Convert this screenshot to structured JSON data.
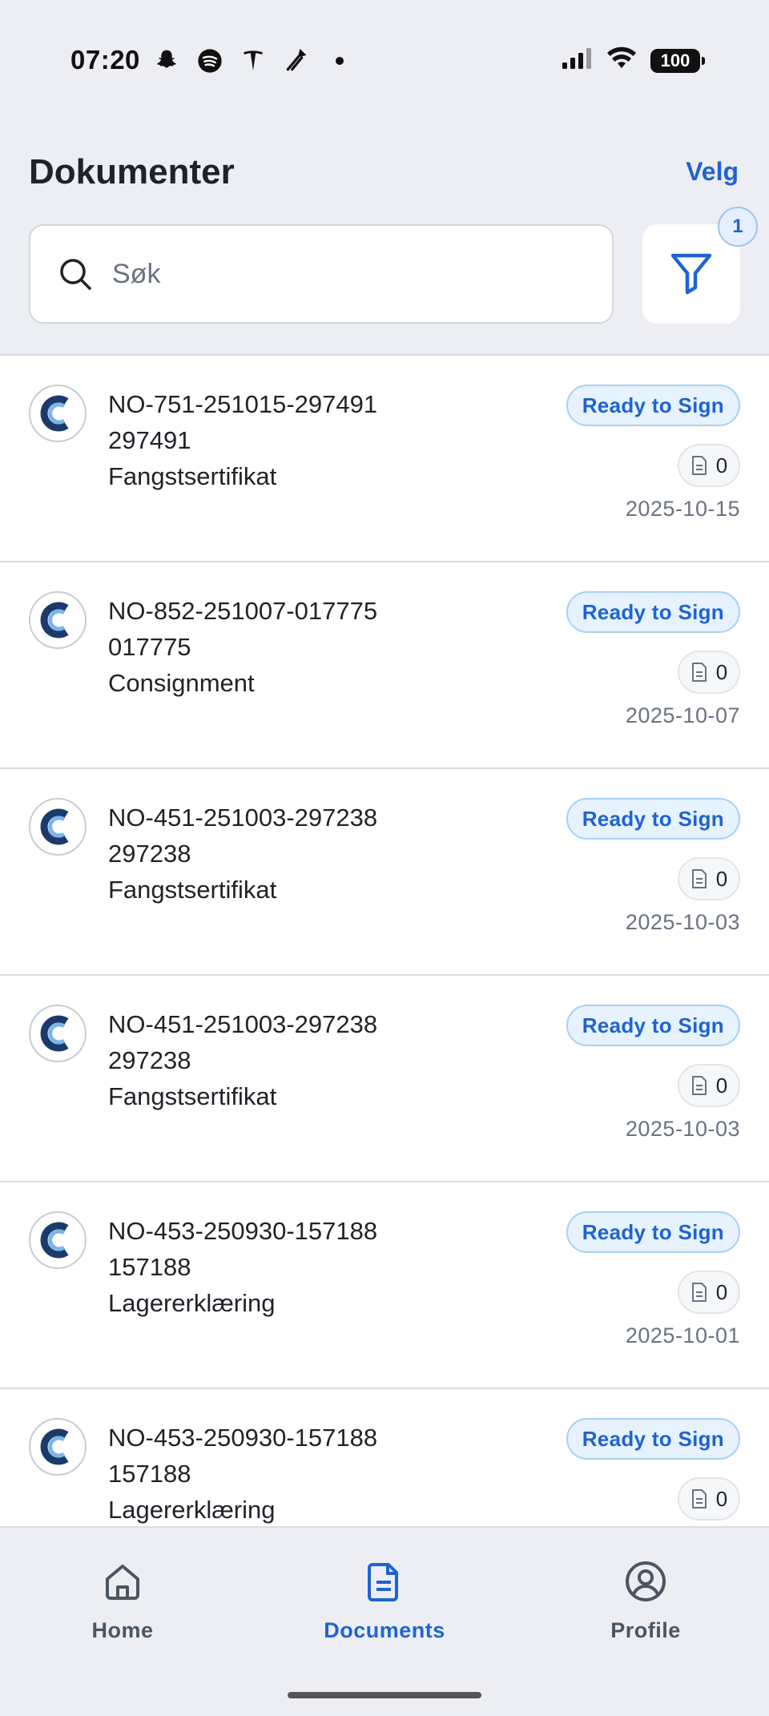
{
  "status_bar": {
    "time": "07:20",
    "battery": "100",
    "left_icons": [
      "snapchat-icon",
      "spotify-icon",
      "tesla-icon",
      "tesla-wrench-icon",
      "dot-icon"
    ],
    "right_icons": [
      "cellular-signal-icon",
      "wifi-icon",
      "battery-icon"
    ]
  },
  "header": {
    "title": "Dokumenter",
    "select_label": "Velg"
  },
  "search": {
    "placeholder": "Søk",
    "value": ""
  },
  "filter": {
    "badge_count": "1"
  },
  "documents": [
    {
      "id": "NO-751-251015-297491",
      "number": "297491",
      "type": "Fangstsertifikat",
      "status": "Ready to Sign",
      "attachments": "0",
      "date": "2025-10-15"
    },
    {
      "id": "NO-852-251007-017775",
      "number": "017775",
      "type": "Consignment",
      "status": "Ready to Sign",
      "attachments": "0",
      "date": "2025-10-07"
    },
    {
      "id": "NO-451-251003-297238",
      "number": "297238",
      "type": "Fangstsertifikat",
      "status": "Ready to Sign",
      "attachments": "0",
      "date": "2025-10-03"
    },
    {
      "id": "NO-451-251003-297238",
      "number": "297238",
      "type": "Fangstsertifikat",
      "status": "Ready to Sign",
      "attachments": "0",
      "date": "2025-10-03"
    },
    {
      "id": "NO-453-250930-157188",
      "number": "157188",
      "type": "Lagererklæring",
      "status": "Ready to Sign",
      "attachments": "0",
      "date": "2025-10-01"
    },
    {
      "id": "NO-453-250930-157188",
      "number": "157188",
      "type": "Lagererklæring",
      "status": "Ready to Sign",
      "attachments": "0",
      "date": ""
    }
  ],
  "bottom_nav": {
    "items": [
      {
        "label": "Home",
        "icon": "home-icon",
        "active": false
      },
      {
        "label": "Documents",
        "icon": "document-icon",
        "active": true
      },
      {
        "label": "Profile",
        "icon": "profile-icon",
        "active": false
      }
    ]
  },
  "colors": {
    "accent": "#1f63d1",
    "header_bg": "#eceef3",
    "pill_bg": "#e6f2fd",
    "text_muted": "#6b7280"
  }
}
